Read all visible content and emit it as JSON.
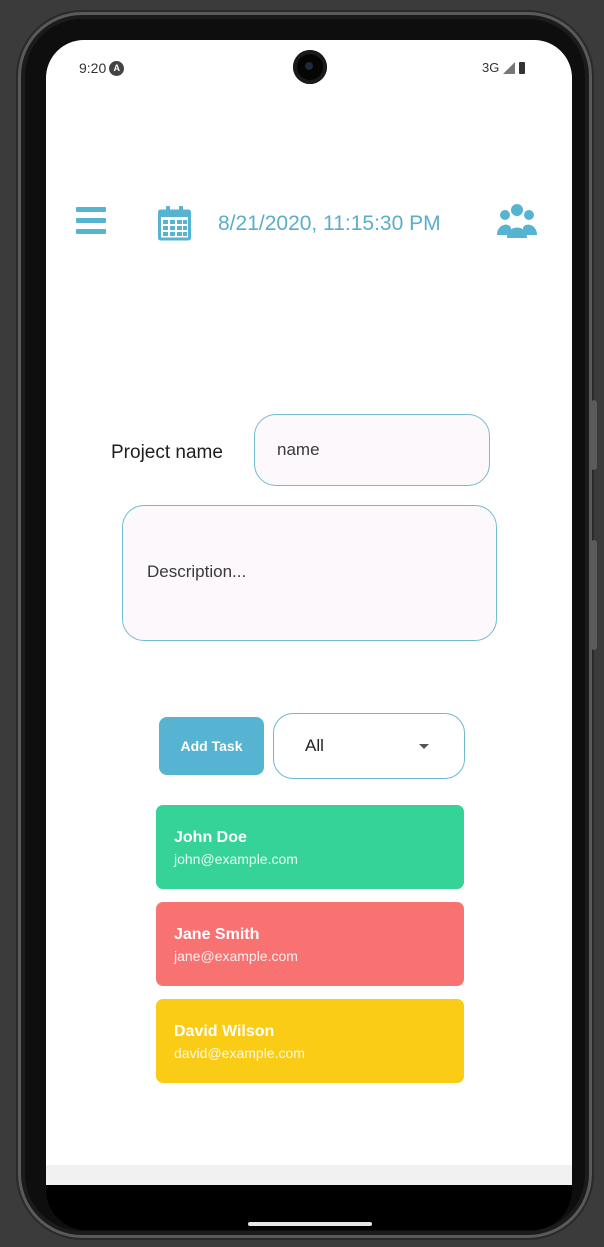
{
  "status_bar": {
    "time": "9:20",
    "network": "3G"
  },
  "header": {
    "datetime": "8/21/2020, 11:15:30 PM",
    "accent_color": "#56b4d2"
  },
  "form": {
    "project_label": "Project name",
    "name_placeholder": "name",
    "description_placeholder": "Description..."
  },
  "toolbar": {
    "add_task_label": "Add Task",
    "filter_selected": "All"
  },
  "users": [
    {
      "name": "John Doe",
      "email": "john@example.com",
      "color": "#36d399"
    },
    {
      "name": "Jane Smith",
      "email": "jane@example.com",
      "color": "#f87272"
    },
    {
      "name": "David Wilson",
      "email": "david@example.com",
      "color": "#facc15"
    }
  ]
}
